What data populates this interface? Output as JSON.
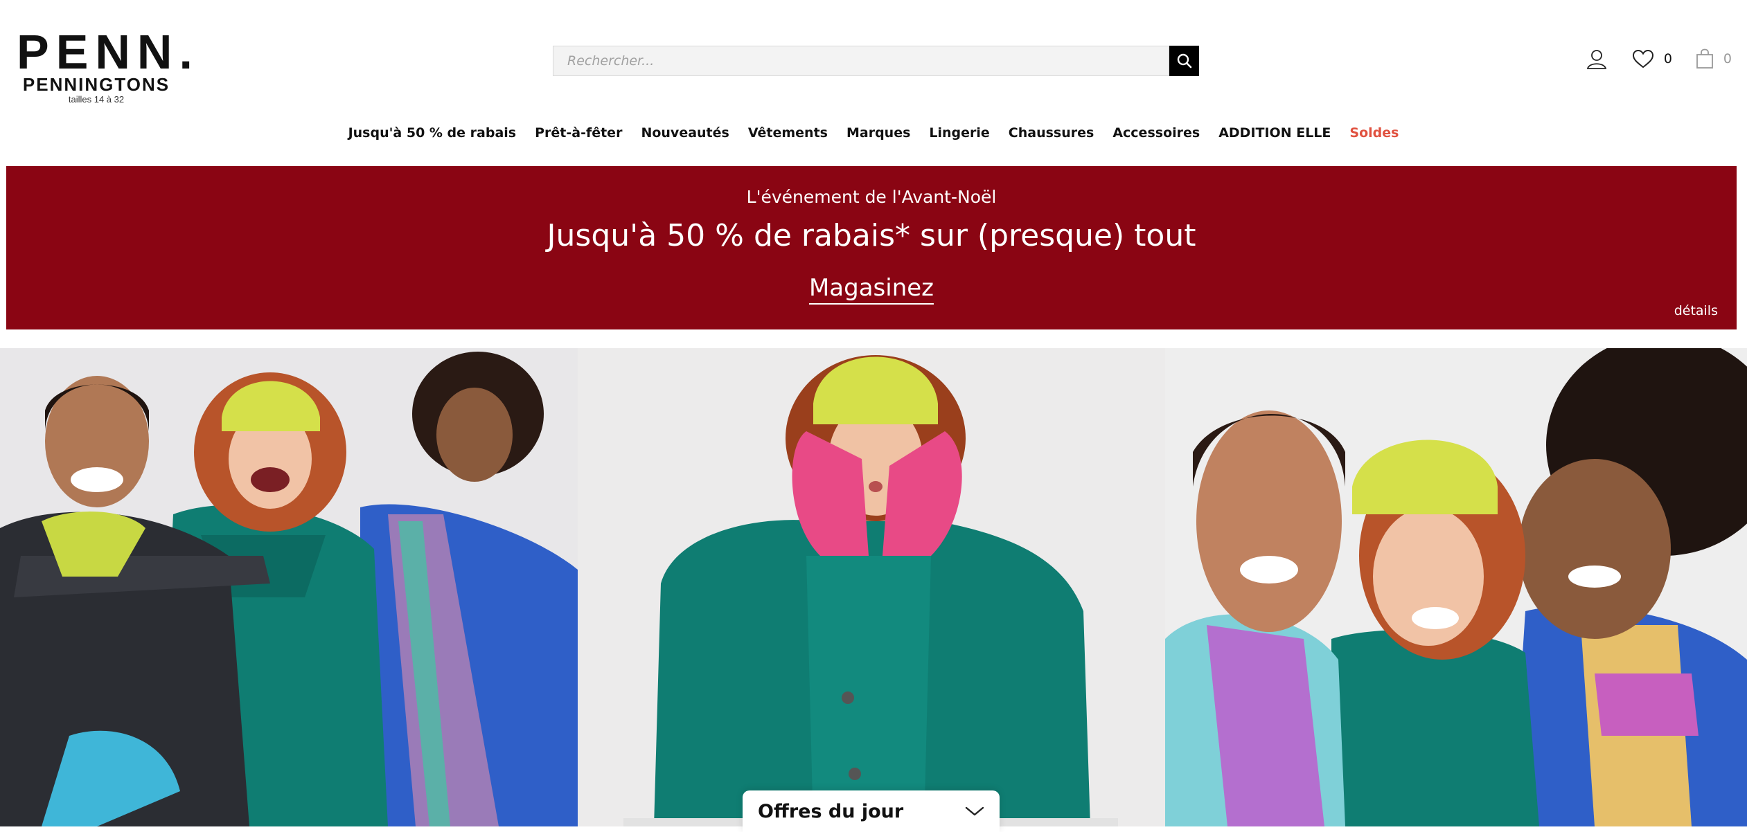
{
  "header": {
    "logo": {
      "main": "PENN.",
      "sub": "PENNINGTONS",
      "tagline": "tailles 14 à 32"
    },
    "search": {
      "placeholder": "Rechercher..."
    },
    "wishlist_count": "0",
    "cart_count": "0"
  },
  "nav": {
    "items": [
      {
        "label": "Jusqu'à 50 % de rabais"
      },
      {
        "label": "Prêt-à-fêter"
      },
      {
        "label": "Nouveautés"
      },
      {
        "label": "Vêtements"
      },
      {
        "label": "Marques"
      },
      {
        "label": "Lingerie"
      },
      {
        "label": "Chaussures"
      },
      {
        "label": "Accessoires"
      },
      {
        "label": "ADDITION ELLE"
      },
      {
        "label": "Soldes"
      }
    ]
  },
  "banner": {
    "kicker": "L'événement de l'Avant-Noël",
    "headline": "Jusqu'à 50 % de rabais* sur (presque) tout",
    "cta": "Magasinez",
    "details": "détails"
  },
  "offers": {
    "label": "Offres du jour"
  },
  "colors": {
    "banner_bg": "#8a0513",
    "sale_accent": "#e0513f",
    "jacket_teal": "#0f7d72",
    "beanie_lime": "#d5e04a",
    "mitten_pink": "#e84a86"
  },
  "icons": [
    "search-icon",
    "account-icon",
    "heart-icon",
    "bag-icon",
    "chevron-down-icon"
  ]
}
